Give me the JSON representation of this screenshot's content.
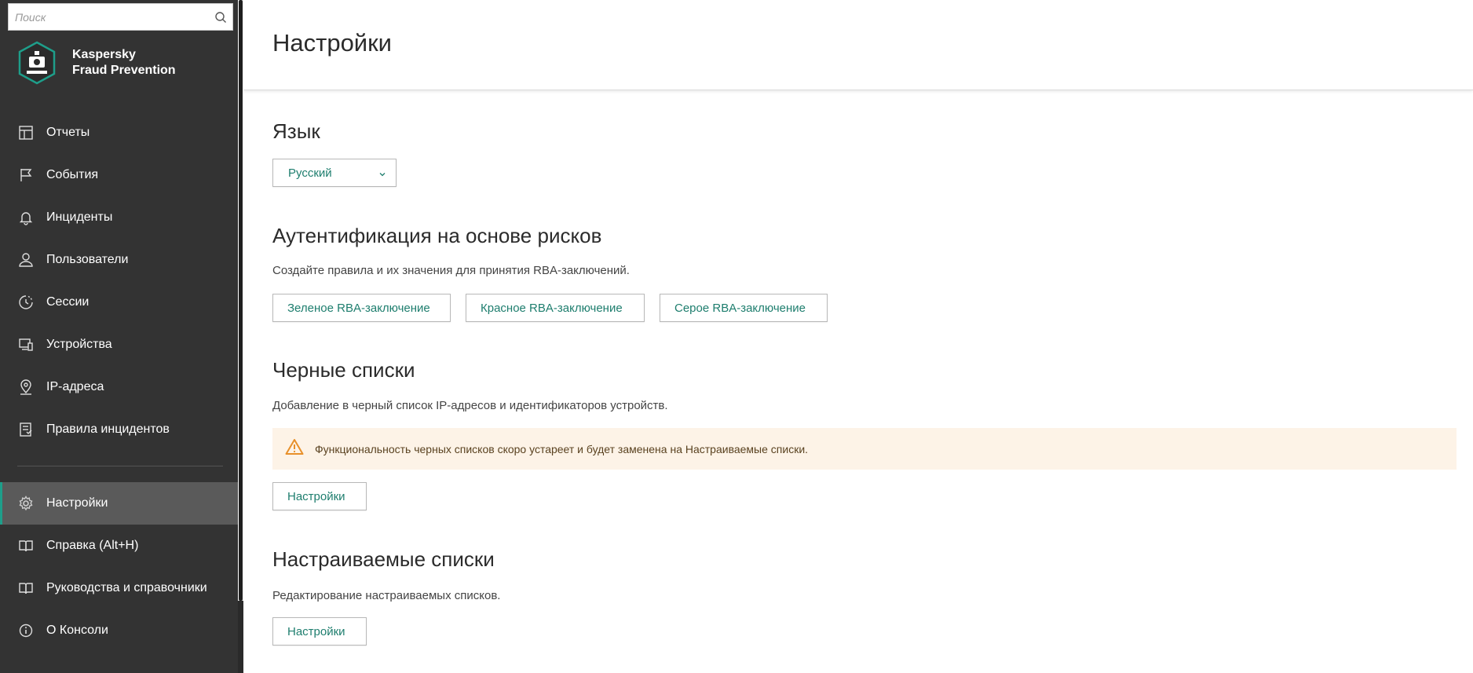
{
  "sidebar": {
    "search": {
      "placeholder": "Поиск",
      "value": ""
    },
    "brand": {
      "line1": "Kaspersky",
      "line2": "Fraud Prevention"
    },
    "items": [
      {
        "label": "Отчеты",
        "icon": "reports-icon"
      },
      {
        "label": "События",
        "icon": "flag-icon"
      },
      {
        "label": "Инциденты",
        "icon": "bell-icon"
      },
      {
        "label": "Пользователи",
        "icon": "user-icon"
      },
      {
        "label": "Сессии",
        "icon": "sessions-icon"
      },
      {
        "label": "Устройства",
        "icon": "devices-icon"
      },
      {
        "label": "IP-адреса",
        "icon": "location-pin-icon"
      },
      {
        "label": "Правила инцидентов",
        "icon": "rules-icon"
      }
    ],
    "bottom_items": [
      {
        "label": "Настройки",
        "icon": "gear-icon",
        "active": true
      },
      {
        "label": "Справка (Alt+H)",
        "icon": "book-icon"
      },
      {
        "label": "Руководства и справочники",
        "icon": "book-icon"
      },
      {
        "label": "О Консоли",
        "icon": "info-icon"
      }
    ]
  },
  "main": {
    "title": "Настройки",
    "language": {
      "title": "Язык",
      "selected": "Русский"
    },
    "rba": {
      "title": "Аутентификация на основе рисков",
      "description": "Создайте правила и их значения для принятия RBA-заключений.",
      "buttons": [
        "Зеленое RBA-заключение",
        "Красное RBA-заключение",
        "Серое RBA-заключение"
      ]
    },
    "blacklists": {
      "title": "Черные списки",
      "description": "Добавление в черный список IP-адресов и идентификаторов устройств.",
      "warning": "Функциональность черных списков скоро устареет и будет заменена на Настраиваемые списки.",
      "button": "Настройки"
    },
    "custom_lists": {
      "title": "Настраиваемые списки",
      "description": "Редактирование настраиваемых списков.",
      "button": "Настройки"
    }
  },
  "colors": {
    "sidebar_bg": "#333333",
    "active_item_bg": "#5a5a5a",
    "accent": "#1e7e6e",
    "warning_bg": "#fdf3e7",
    "warning_icon": "#e8902a"
  }
}
